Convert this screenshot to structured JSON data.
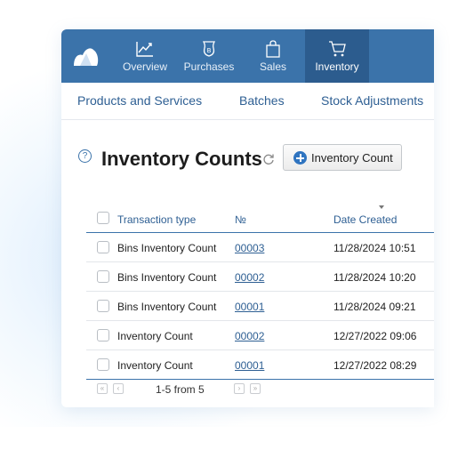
{
  "nav": {
    "items": [
      {
        "label": "Overview",
        "icon": "chart-line-icon"
      },
      {
        "label": "Purchases",
        "icon": "bag-bitcoin-icon"
      },
      {
        "label": "Sales",
        "icon": "shopping-bag-icon"
      },
      {
        "label": "Inventory",
        "icon": "cart-icon",
        "active": true
      }
    ],
    "active_color": "#2c5c8e",
    "bar_color": "#3b73aa"
  },
  "subnav": {
    "items": [
      "Products and Services",
      "Batches",
      "Stock Adjustments"
    ]
  },
  "page": {
    "title": "Inventory Counts",
    "add_button_label": "Inventory Count"
  },
  "table": {
    "columns": [
      "Transaction type",
      "№",
      "Date Created"
    ],
    "rows": [
      {
        "type": "Bins Inventory Count",
        "number": "00003",
        "date": "11/28/2024 10:51"
      },
      {
        "type": "Bins Inventory Count",
        "number": "00002",
        "date": "11/28/2024 10:20"
      },
      {
        "type": "Bins Inventory Count",
        "number": "00001",
        "date": "11/28/2024 09:21"
      },
      {
        "type": "Inventory Count",
        "number": "00002",
        "date": "12/27/2022 09:06"
      },
      {
        "type": "Inventory Count",
        "number": "00001",
        "date": "12/27/2022 08:29"
      }
    ]
  },
  "pager": {
    "text": "1-5 from 5"
  }
}
